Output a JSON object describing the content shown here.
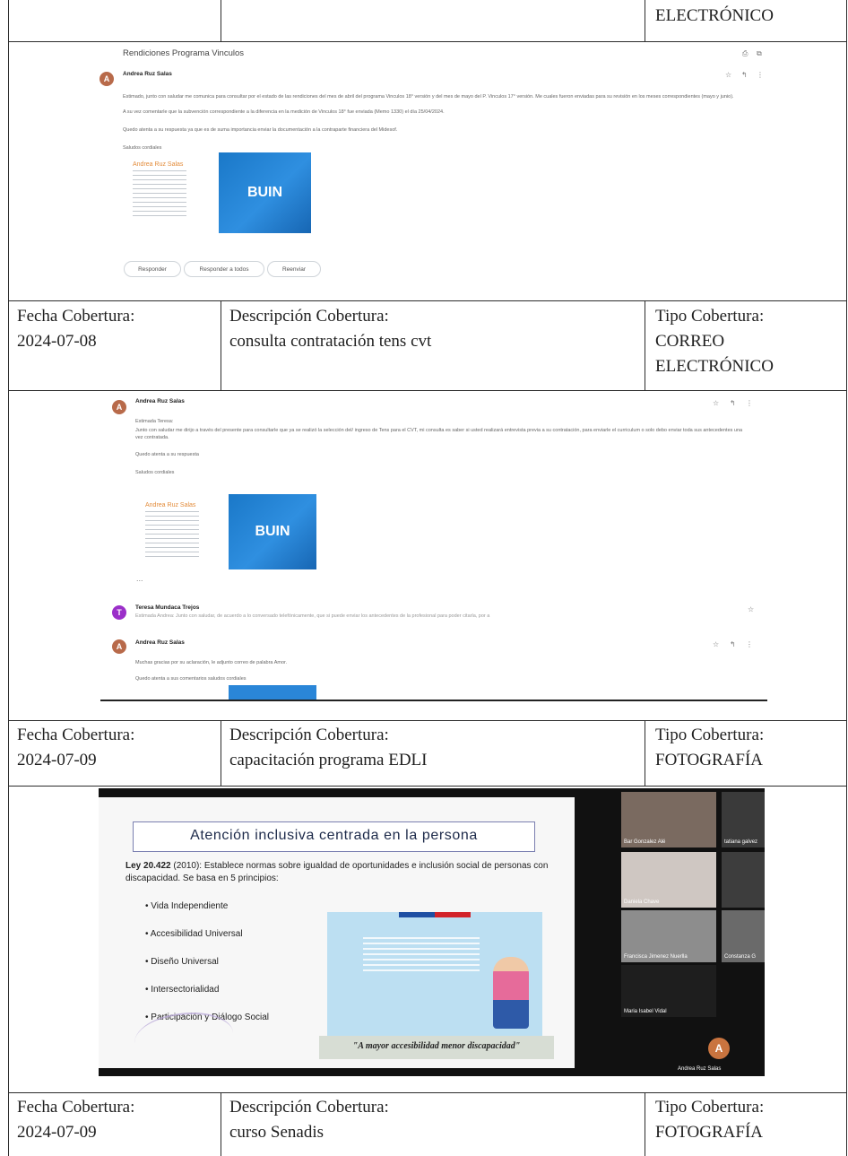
{
  "top_row": {
    "type_tail": "ELECTRÓNICO"
  },
  "labels": {
    "fecha": "Fecha Cobertura:",
    "descripcion": "Descripción Cobertura:",
    "tipo": "Tipo Cobertura:"
  },
  "rows": [
    {
      "fecha": "2024-07-08",
      "descripcion": "consulta contratación tens cvt",
      "tipo_1": "CORREO",
      "tipo_2": "ELECTRÓNICO"
    },
    {
      "fecha": "2024-07-09",
      "descripcion": "capacitación programa EDLI",
      "tipo_1": "FOTOGRAFÍA"
    },
    {
      "fecha": "2024-07-09",
      "descripcion": "curso Senadis",
      "tipo_1": "FOTOGRAFÍA"
    }
  ],
  "email1": {
    "subject": "Rendiciones Programa Vinculos",
    "sender": "Andrea Ruz Salas",
    "avatar_letter": "A",
    "greeting": "Estimado, junto con saludar me comunica para consultar por el estado de las rendiciones del mes de abril del programa Vinculos 18° versión y del mes de mayo del P. Vinculos 17° versión. Me cuales fueron enviadas para su revisión en los meses correspondientes (mayo y junio).",
    "line2": "A su vez comentarle que la subvención correspondiente a la diferencia en la medición de Vinculos 18° fue enviada (Memo 1330) el día 25/04/2024.",
    "line3": "Quedo atenta a su respuesta ya que es de suma importancia enviar la documentación a la contraparte financiera del Midesof.",
    "closing": "Saludos cordiales",
    "sig_name": "Andrea Ruz Salas",
    "logo": "BUIN",
    "btn_reply": "Responder",
    "btn_reply_all": "Responder a todos",
    "btn_forward": "Reenviar"
  },
  "email2": {
    "sender": "Andrea Ruz Salas",
    "avatar_letter": "A",
    "salutation": "Estimada Teresa:",
    "body": "Junto con saludar me dirijo a través del presente para consultarle que ya se realizó la selección del/ ingreso de Tens para el CVT, mi consulta es saber si usted realizará entrevista previa a su contratación, para enviarle el curriculum o solo debo enviar toda sus antecedentes una vez contratada.",
    "line2": "Quedo atenta a su respuesta",
    "closing": "Saludos cordiales",
    "sig_name": "Andrea Ruz Salas",
    "logo": "BUIN",
    "ellipsis": "...",
    "reply_sender": "Teresa Mundaca Trejos",
    "reply_letter": "T",
    "reply_preview": "Estimada Andrea: Junto con saludar, de acuerdo a lo conversado telefónicamente, que si puede enviar los antecedentes de la profesional para poder citarla, por a",
    "third_sender": "Andrea Ruz Salas",
    "third_letter": "A",
    "third_body": "Muchas gracias por su aclaración, le adjunto correo de palabra Amor.",
    "third_line2": "Quedo atenta a sus comentarios saludos cordiales"
  },
  "slide": {
    "title": "Atención inclusiva centrada en la persona",
    "law_bold": "Ley 20.422",
    "law_rest": " (2010): Establece normas sobre igualdad de oportunidades e inclusión social de personas con discapacidad. Se basa en 5 principios:",
    "principles": [
      "Vida Independiente",
      "Accesibilidad Universal",
      "Diseño Universal",
      "Intersectorialidad",
      "Participación y Diálogo Social"
    ],
    "quote": "\"A mayor accesibilidad menor discapacidad\"",
    "participants": [
      "Bar Gonzalez Alé",
      "tatiana galvez",
      "Daniela Chave",
      "Francisca Jimenez Nuerlla",
      "Constanza G",
      "Maria Isabel Vidal",
      "Andrea Ruz Salas"
    ],
    "me_letter": "A"
  }
}
